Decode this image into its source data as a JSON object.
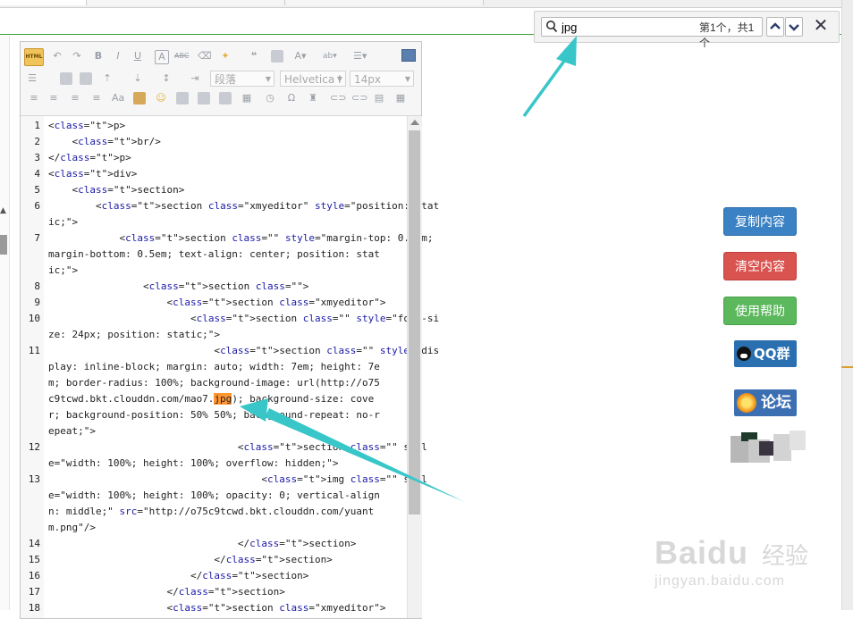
{
  "find_bar": {
    "query": "jpg",
    "match_count": "第1个，共1个",
    "prev_icon": "chevron-up-icon",
    "next_icon": "chevron-down-icon",
    "close_label": "✕"
  },
  "editor": {
    "toolbar": {
      "html_label": "HTML",
      "paragraph_select": "段落",
      "font_select": "Helvetica I",
      "size_select": "14px"
    },
    "code_lines": [
      {
        "n": "1",
        "text": "<p>"
      },
      {
        "n": "2",
        "text": "    <br/>"
      },
      {
        "n": "3",
        "text": "</p>"
      },
      {
        "n": "4",
        "text": "<div>"
      },
      {
        "n": "5",
        "text": "    <section>"
      },
      {
        "n": "6",
        "text": "        <section class=\"xmyeditor\" style=\"position: stat"
      },
      {
        "n": "",
        "text": "ic;\">"
      },
      {
        "n": "7",
        "text": "            <section class=\"\" style=\"margin-top: 0.5em;"
      },
      {
        "n": "",
        "text": "margin-bottom: 0.5em; text-align: center; position: stat"
      },
      {
        "n": "",
        "text": "ic;\">"
      },
      {
        "n": "8",
        "text": "                <section class=\"\">"
      },
      {
        "n": "9",
        "text": "                    <section class=\"xmyeditor\">"
      },
      {
        "n": "10",
        "text": "                        <section class=\"\" style=\"font-si"
      },
      {
        "n": "",
        "text": "ze: 24px; position: static;\">"
      },
      {
        "n": "11",
        "text": "                            <section class=\"\" style=\"dis"
      },
      {
        "n": "",
        "text": "play: inline-block; margin: auto; width: 7em; height: 7e"
      },
      {
        "n": "",
        "text": "m; border-radius: 100%; background-image: url(http://o75"
      },
      {
        "n": "",
        "text": "c9tcwd.bkt.clouddn.com/mao7.",
        "match": "jpg",
        "after": "); background-size: cove"
      },
      {
        "n": "",
        "text": "r; background-position: 50% 50%; background-repeat: no-r"
      },
      {
        "n": "",
        "text": "epeat;\">"
      },
      {
        "n": "12",
        "text": "                                <section class=\"\" styl"
      },
      {
        "n": "",
        "text": "e=\"width: 100%; height: 100%; overflow: hidden;\">"
      },
      {
        "n": "13",
        "text": "                                    <img class=\"\" styl"
      },
      {
        "n": "",
        "text": "e=\"width: 100%; height: 100%; opacity: 0; vertical-align"
      },
      {
        "n": "",
        "text": "n: middle;\" src=\"http://o75c9tcwd.bkt.clouddn.com/yuant"
      },
      {
        "n": "",
        "text": "m.png\"/>"
      },
      {
        "n": "14",
        "text": "                                </section>"
      },
      {
        "n": "15",
        "text": "                            </section>"
      },
      {
        "n": "16",
        "text": "                        </section>"
      },
      {
        "n": "17",
        "text": "                    </section>"
      },
      {
        "n": "18",
        "text": "                    <section class=\"xmyeditor\">"
      }
    ]
  },
  "side_buttons": {
    "copy": "复制内容",
    "clear": "清空内容",
    "help": "使用帮助",
    "qq": "QQ群",
    "forum": "论坛"
  },
  "watermark": {
    "logo": "Baidu",
    "jingyan": "经验",
    "url": "jingyan.baidu.com"
  },
  "colors": {
    "match_highlight": "#ff9632",
    "arrow": "#39c6c9",
    "copy_button": "#3b82c5",
    "clear_button": "#d9534f",
    "help_button": "#5cb85c"
  }
}
